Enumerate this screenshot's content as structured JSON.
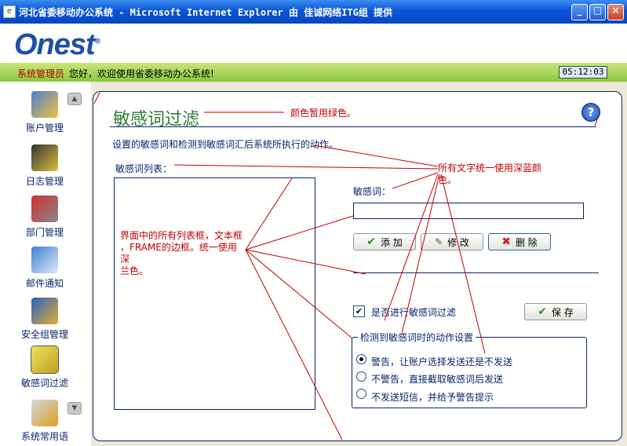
{
  "window": {
    "title": "河北省委移动办公系统 - Microsoft Internet Explorer 由 佳诚网络ITG组 提供",
    "minimize": "_",
    "maximize": "□",
    "close": "×"
  },
  "header": {
    "logo": "Onest",
    "logo_mark": "®",
    "role": "系统管理员",
    "welcome": "您好，欢迎使用省委移动办公系统!",
    "clock": "05:12:03"
  },
  "sidebar": {
    "items": [
      {
        "label": "账户管理",
        "icon": "account-icon"
      },
      {
        "label": "日志管理",
        "icon": "log-icon"
      },
      {
        "label": "部门管理",
        "icon": "department-icon"
      },
      {
        "label": "邮件通知",
        "icon": "mail-icon"
      },
      {
        "label": "安全组管理",
        "icon": "security-group-icon"
      },
      {
        "label": "敏感词过滤",
        "icon": "filter-icon"
      },
      {
        "label": "系统常用语",
        "icon": "phrases-icon"
      }
    ],
    "scroll_up": "▲",
    "scroll_down": "▼"
  },
  "page": {
    "title": "敏感词过滤",
    "help": "?",
    "description": "设置的敏感词和检测到敏感词汇后系统所执行的动作。",
    "list_label": "敏感词列表：",
    "word_label": "敏感词：",
    "word_value": "",
    "add_label": "添 加",
    "edit_label": "修 改",
    "delete_label": "删 除",
    "enable_filter_label": "是否进行敏感词过滤",
    "enable_filter_checked": true,
    "save_label": "保 存",
    "action_group_title": "检测到敏感词时的动作设置",
    "actions": [
      {
        "label": "警告，让账户选择发送还是不发送",
        "selected": true
      },
      {
        "label": "不警告，直接截取敏感词后发送",
        "selected": false
      },
      {
        "label": "不发送短信，并给予警告提示",
        "selected": false
      }
    ]
  },
  "annotations": {
    "title_color_note": "颜色暂用绿色。",
    "text_color_note_line1": "所有文字统一使用深蓝颜",
    "text_color_note_line2": "色。",
    "border_note_line1": "界面中的所有列表框，文本框",
    "border_note_line2": "，FRAME的边框。统一使用深",
    "border_note_line3": "兰色。",
    "note_color": "#c00000"
  },
  "colors": {
    "title_bar": "#0a55d8",
    "header_green": "#8cc63e",
    "dark_blue": "#0a246a",
    "title_green": "#2e7d32"
  }
}
